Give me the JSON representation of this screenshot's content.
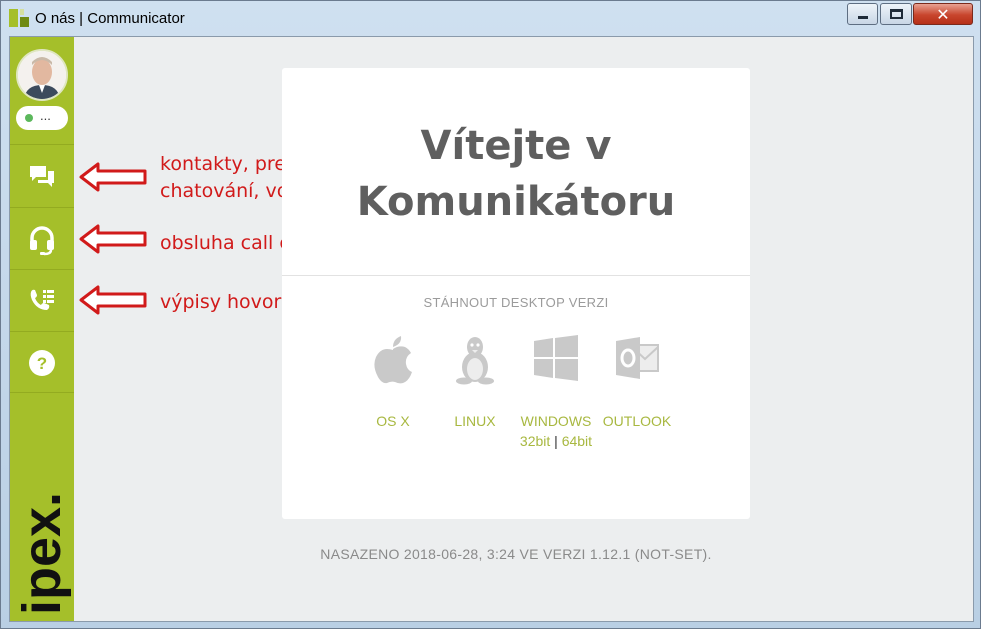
{
  "window": {
    "title": "O nás | Communicator",
    "controls": {
      "minimize": "minimize",
      "maximize": "maximize",
      "close": "✕"
    }
  },
  "sidebar": {
    "status": "...",
    "status_color": "#5cb85c",
    "accent": "#a5bf2a",
    "items": [
      {
        "icon": "chat-icon"
      },
      {
        "icon": "headset-icon"
      },
      {
        "icon": "call-log-icon"
      },
      {
        "icon": "help-icon",
        "label": "?"
      }
    ],
    "logo": "ipex."
  },
  "annotations": {
    "color": "#d11a1a",
    "notes": [
      "kontakty, prezence,\nchatování, volání",
      "obsluha call centra",
      "výpisy hovorů"
    ]
  },
  "main": {
    "welcome_line1": "Vítejte v",
    "welcome_line2": "Komunikátoru",
    "download_title": "STÁHNOUT DESKTOP VERZI",
    "downloads": [
      {
        "icon": "apple-icon",
        "label": "OS X"
      },
      {
        "icon": "linux-icon",
        "label": "LINUX"
      },
      {
        "icon": "windows-icon",
        "label": "WINDOWS"
      },
      {
        "icon": "outlook-icon",
        "label": "OUTLOOK"
      }
    ],
    "win_32": "32bit",
    "win_sep": "|",
    "win_64": "64bit",
    "footer": "NASAZENO 2018-06-28, 3:24 VE VERZI 1.12.1 (NOT-SET)."
  }
}
